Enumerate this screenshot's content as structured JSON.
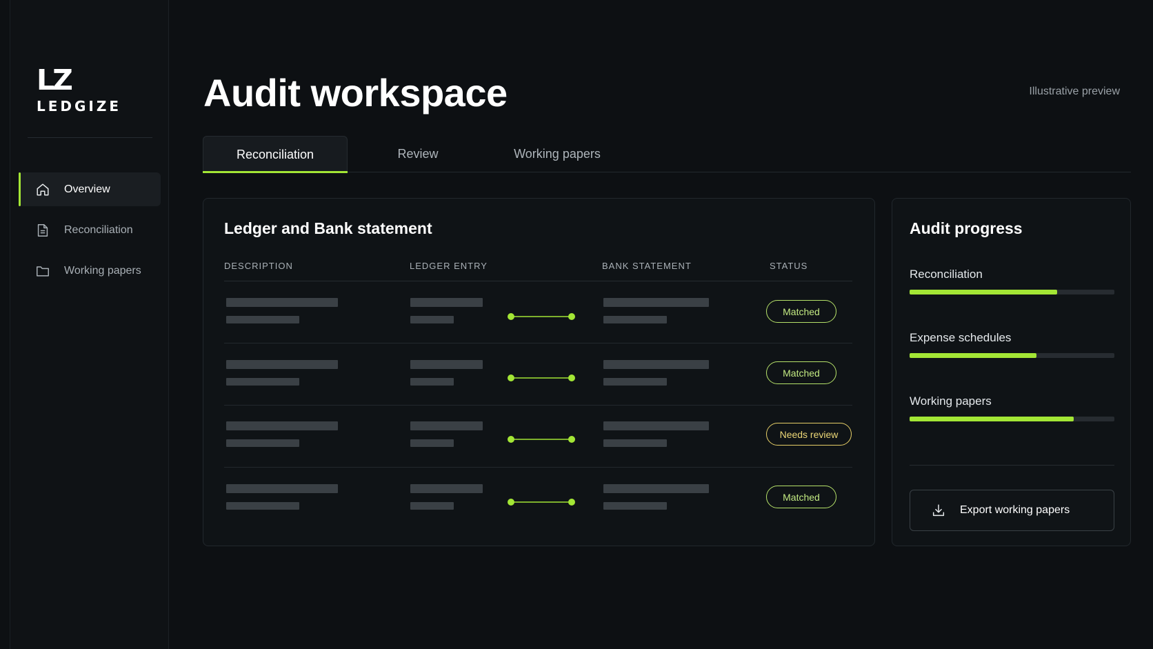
{
  "brand": {
    "mark": "LZ",
    "name": "LEDGIZE"
  },
  "sidebar": {
    "items": [
      {
        "label": "Overview",
        "icon": "home-icon",
        "active": true
      },
      {
        "label": "Reconciliation",
        "icon": "document-icon",
        "active": false
      },
      {
        "label": "Working papers",
        "icon": "folder-icon",
        "active": false
      }
    ]
  },
  "header": {
    "title": "Audit workspace",
    "note": "Illustrative preview"
  },
  "tabs": [
    {
      "label": "Reconciliation",
      "active": true
    },
    {
      "label": "Review",
      "active": false
    },
    {
      "label": "Working papers",
      "active": false
    }
  ],
  "ledger": {
    "title": "Ledger and  Bank statement",
    "columns": [
      "DESCRIPTION",
      "LEDGER ENTRY",
      "BANK STATEMENT",
      "STATUS"
    ],
    "rows": [
      {
        "status": "Matched"
      },
      {
        "status": "Matched"
      },
      {
        "status": "Needs review"
      },
      {
        "status": "Matched"
      }
    ]
  },
  "progress": {
    "title": "Audit progress",
    "items": [
      {
        "label": "Reconciliation",
        "percent": 72
      },
      {
        "label": "Expense schedules",
        "percent": 62
      },
      {
        "label": "Working papers",
        "percent": 80
      }
    ],
    "export_label": "Export working papers"
  },
  "colors": {
    "accent": "#a3e635",
    "matched": "#b7e36a",
    "needs_review": "#e7cf67",
    "background": "#0d1013"
  }
}
